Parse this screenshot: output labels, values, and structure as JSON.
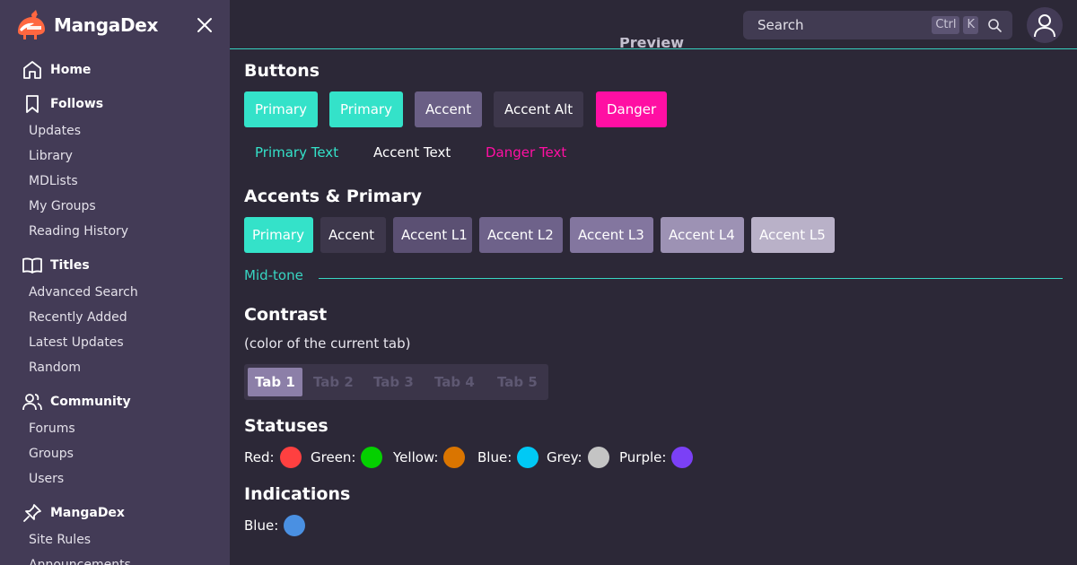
{
  "brand": {
    "name": "MangaDex"
  },
  "sidebar": {
    "sections": [
      {
        "label": "Home",
        "icon": "home-icon"
      },
      {
        "label": "Follows",
        "icon": "bookmark-icon"
      },
      {
        "label": "Titles",
        "icon": "book-open-icon"
      },
      {
        "label": "Community",
        "icon": "users-icon"
      },
      {
        "label": "MangaDex",
        "icon": "pin-icon"
      }
    ],
    "follows_items": [
      "Updates",
      "Library",
      "MDLists",
      "My Groups",
      "Reading History"
    ],
    "titles_items": [
      "Advanced Search",
      "Recently Added",
      "Latest Updates",
      "Random"
    ],
    "community_items": [
      "Forums",
      "Groups",
      "Users"
    ],
    "mangadex_items": [
      "Site Rules",
      "Announcements"
    ]
  },
  "search": {
    "placeholder": "Search",
    "kbd_ctrl": "Ctrl",
    "kbd_k": "K"
  },
  "preview_heading": "Preview",
  "buttons_section": {
    "title": "Buttons",
    "buttons": [
      "Primary",
      "Primary",
      "Accent",
      "Accent Alt",
      "Danger"
    ],
    "text_buttons": [
      "Primary Text",
      "Accent Text",
      "Danger Text"
    ]
  },
  "accents_section": {
    "title": "Accents & Primary",
    "chips": [
      "Primary",
      "Accent",
      "Accent L1",
      "Accent L2",
      "Accent L3",
      "Accent L4",
      "Accent L5"
    ],
    "divider_label": "Mid-tone"
  },
  "contrast_section": {
    "title": "Contrast",
    "subtitle": "(color of the current tab)",
    "tabs": [
      "Tab 1",
      "Tab 2",
      "Tab 3",
      "Tab 4",
      "Tab 5"
    ]
  },
  "statuses_section": {
    "title": "Statuses",
    "items": [
      {
        "label": "Red:",
        "color": "#ff4040"
      },
      {
        "label": "Green:",
        "color": "#04d000"
      },
      {
        "label": "Yellow:",
        "color": "#da7500"
      },
      {
        "label": "Blue:",
        "color": "#00c9f5"
      },
      {
        "label": "Grey:",
        "color": "#c4c4c4"
      },
      {
        "label": "Purple:",
        "color": "#7b40f6"
      }
    ]
  },
  "indications_section": {
    "title": "Indications",
    "items": [
      {
        "label": "Blue:",
        "color": "#4a90e2"
      }
    ]
  },
  "colors": {
    "primary": "#34e2c9",
    "accent": "#3d374b",
    "danger": "#ff0fa3",
    "sidebar_bg": "#433b56",
    "page_bg": "#2c2837"
  }
}
